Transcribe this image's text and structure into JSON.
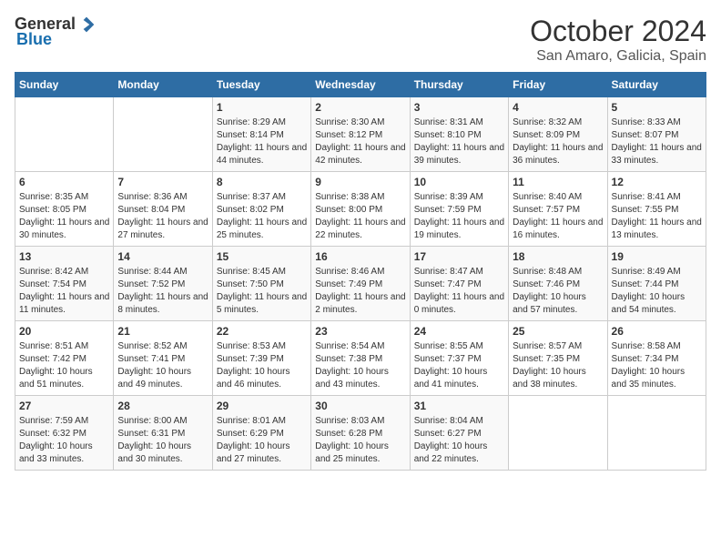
{
  "header": {
    "logo_general": "General",
    "logo_blue": "Blue",
    "title": "October 2024",
    "subtitle": "San Amaro, Galicia, Spain"
  },
  "weekdays": [
    "Sunday",
    "Monday",
    "Tuesday",
    "Wednesday",
    "Thursday",
    "Friday",
    "Saturday"
  ],
  "weeks": [
    [
      {
        "day": "",
        "info": ""
      },
      {
        "day": "",
        "info": ""
      },
      {
        "day": "1",
        "info": "Sunrise: 8:29 AM\nSunset: 8:14 PM\nDaylight: 11 hours and 44 minutes."
      },
      {
        "day": "2",
        "info": "Sunrise: 8:30 AM\nSunset: 8:12 PM\nDaylight: 11 hours and 42 minutes."
      },
      {
        "day": "3",
        "info": "Sunrise: 8:31 AM\nSunset: 8:10 PM\nDaylight: 11 hours and 39 minutes."
      },
      {
        "day": "4",
        "info": "Sunrise: 8:32 AM\nSunset: 8:09 PM\nDaylight: 11 hours and 36 minutes."
      },
      {
        "day": "5",
        "info": "Sunrise: 8:33 AM\nSunset: 8:07 PM\nDaylight: 11 hours and 33 minutes."
      }
    ],
    [
      {
        "day": "6",
        "info": "Sunrise: 8:35 AM\nSunset: 8:05 PM\nDaylight: 11 hours and 30 minutes."
      },
      {
        "day": "7",
        "info": "Sunrise: 8:36 AM\nSunset: 8:04 PM\nDaylight: 11 hours and 27 minutes."
      },
      {
        "day": "8",
        "info": "Sunrise: 8:37 AM\nSunset: 8:02 PM\nDaylight: 11 hours and 25 minutes."
      },
      {
        "day": "9",
        "info": "Sunrise: 8:38 AM\nSunset: 8:00 PM\nDaylight: 11 hours and 22 minutes."
      },
      {
        "day": "10",
        "info": "Sunrise: 8:39 AM\nSunset: 7:59 PM\nDaylight: 11 hours and 19 minutes."
      },
      {
        "day": "11",
        "info": "Sunrise: 8:40 AM\nSunset: 7:57 PM\nDaylight: 11 hours and 16 minutes."
      },
      {
        "day": "12",
        "info": "Sunrise: 8:41 AM\nSunset: 7:55 PM\nDaylight: 11 hours and 13 minutes."
      }
    ],
    [
      {
        "day": "13",
        "info": "Sunrise: 8:42 AM\nSunset: 7:54 PM\nDaylight: 11 hours and 11 minutes."
      },
      {
        "day": "14",
        "info": "Sunrise: 8:44 AM\nSunset: 7:52 PM\nDaylight: 11 hours and 8 minutes."
      },
      {
        "day": "15",
        "info": "Sunrise: 8:45 AM\nSunset: 7:50 PM\nDaylight: 11 hours and 5 minutes."
      },
      {
        "day": "16",
        "info": "Sunrise: 8:46 AM\nSunset: 7:49 PM\nDaylight: 11 hours and 2 minutes."
      },
      {
        "day": "17",
        "info": "Sunrise: 8:47 AM\nSunset: 7:47 PM\nDaylight: 11 hours and 0 minutes."
      },
      {
        "day": "18",
        "info": "Sunrise: 8:48 AM\nSunset: 7:46 PM\nDaylight: 10 hours and 57 minutes."
      },
      {
        "day": "19",
        "info": "Sunrise: 8:49 AM\nSunset: 7:44 PM\nDaylight: 10 hours and 54 minutes."
      }
    ],
    [
      {
        "day": "20",
        "info": "Sunrise: 8:51 AM\nSunset: 7:42 PM\nDaylight: 10 hours and 51 minutes."
      },
      {
        "day": "21",
        "info": "Sunrise: 8:52 AM\nSunset: 7:41 PM\nDaylight: 10 hours and 49 minutes."
      },
      {
        "day": "22",
        "info": "Sunrise: 8:53 AM\nSunset: 7:39 PM\nDaylight: 10 hours and 46 minutes."
      },
      {
        "day": "23",
        "info": "Sunrise: 8:54 AM\nSunset: 7:38 PM\nDaylight: 10 hours and 43 minutes."
      },
      {
        "day": "24",
        "info": "Sunrise: 8:55 AM\nSunset: 7:37 PM\nDaylight: 10 hours and 41 minutes."
      },
      {
        "day": "25",
        "info": "Sunrise: 8:57 AM\nSunset: 7:35 PM\nDaylight: 10 hours and 38 minutes."
      },
      {
        "day": "26",
        "info": "Sunrise: 8:58 AM\nSunset: 7:34 PM\nDaylight: 10 hours and 35 minutes."
      }
    ],
    [
      {
        "day": "27",
        "info": "Sunrise: 7:59 AM\nSunset: 6:32 PM\nDaylight: 10 hours and 33 minutes."
      },
      {
        "day": "28",
        "info": "Sunrise: 8:00 AM\nSunset: 6:31 PM\nDaylight: 10 hours and 30 minutes."
      },
      {
        "day": "29",
        "info": "Sunrise: 8:01 AM\nSunset: 6:29 PM\nDaylight: 10 hours and 27 minutes."
      },
      {
        "day": "30",
        "info": "Sunrise: 8:03 AM\nSunset: 6:28 PM\nDaylight: 10 hours and 25 minutes."
      },
      {
        "day": "31",
        "info": "Sunrise: 8:04 AM\nSunset: 6:27 PM\nDaylight: 10 hours and 22 minutes."
      },
      {
        "day": "",
        "info": ""
      },
      {
        "day": "",
        "info": ""
      }
    ]
  ]
}
